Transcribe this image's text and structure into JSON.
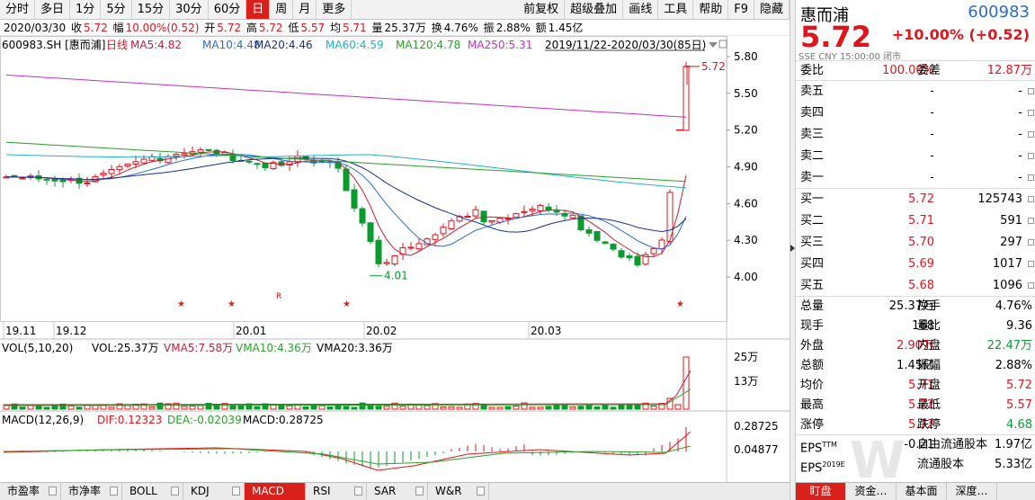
{
  "toolbar": {
    "left_items": [
      "分时",
      "多日",
      "1分",
      "5分",
      "15分",
      "30分",
      "60分",
      "日",
      "周",
      "月",
      "更多"
    ],
    "active": "日",
    "right_items": [
      "前复权",
      "超级叠加",
      "画线",
      "工具",
      "帮助",
      "F9",
      "隐藏"
    ]
  },
  "infoline": {
    "date": "2020/03/30",
    "close_label": "收",
    "close": "5.72",
    "range_label": "幅",
    "range": "10.00%(0.52)",
    "open_label": "开",
    "open": "5.72",
    "high_label": "高",
    "high": "5.72",
    "low_label": "低",
    "low": "5.57",
    "avg_label": "均",
    "avg": "5.71",
    "volume_label": "量",
    "volume": "25.37万",
    "turnover_label": "换",
    "turnover": "4.76%",
    "amp_label": "振",
    "amp": "2.88%",
    "amount_label": "额",
    "amount": "1.45亿"
  },
  "kline_legend": {
    "code": "600983.SH [惠而浦]",
    "period": "日线",
    "ma5": "MA5:4.82",
    "ma10": "MA10:4.48",
    "ma20": "MA20:4.46",
    "ma60": "MA60:4.59",
    "ma120": "MA120:4.78",
    "ma250": "MA250:5.31",
    "range_text": "2019/11/22-2020/03/30(85日)"
  },
  "price_axis": [
    "5.80",
    "5.50",
    "5.20",
    "4.90",
    "4.60",
    "4.30",
    "4.00"
  ],
  "date_axis": [
    "19.11",
    "19.12",
    "20.01",
    "20.02",
    "20.03"
  ],
  "annotations": {
    "low_label": "4.01",
    "last_label": "5.72",
    "r_mark": "R"
  },
  "vol_legend": {
    "name": "VOL(5,10,20)",
    "vol": "VOL:25.37万",
    "vma5": "VMA5:7.58万",
    "vma10": "VMA10:4.36万",
    "vma20": "VMA20:3.36万"
  },
  "vol_axis": [
    "25万",
    "13万"
  ],
  "macd_legend": {
    "name": "MACD(12,26,9)",
    "dif": "DIF:0.12323",
    "dea": "DEA:-0.02039",
    "macd": "MACD:0.28725"
  },
  "macd_axis": [
    "0.28725",
    "0.04877"
  ],
  "indicator_tabs": [
    "市盈率",
    "市净率",
    "BOLL",
    "KDJ",
    "MACD",
    "RSI",
    "SAR",
    "W&R"
  ],
  "indicator_active": "MACD",
  "quote": {
    "name": "惠而浦",
    "code": "600983",
    "price": "5.72",
    "change": "+10.00% (+0.52)",
    "sub": "SSE  CNY  15:00:00  闭市",
    "weibi_label": "委比",
    "weibi": "100.00%",
    "weicha_label": "委差",
    "weicha": "12.87万",
    "asks": [
      {
        "label": "卖五",
        "price": "-",
        "vol": "-"
      },
      {
        "label": "卖四",
        "price": "-",
        "vol": "-"
      },
      {
        "label": "卖三",
        "price": "-",
        "vol": "-"
      },
      {
        "label": "卖二",
        "price": "-",
        "vol": "-"
      },
      {
        "label": "卖一",
        "price": "-",
        "vol": "-"
      }
    ],
    "bids": [
      {
        "label": "买一",
        "price": "5.72",
        "vol": "125743"
      },
      {
        "label": "买二",
        "price": "5.71",
        "vol": "591"
      },
      {
        "label": "买三",
        "price": "5.70",
        "vol": "297"
      },
      {
        "label": "买四",
        "price": "5.69",
        "vol": "1017"
      },
      {
        "label": "买五",
        "price": "5.68",
        "vol": "1096"
      }
    ],
    "stats": [
      {
        "l1": "总量",
        "v1": "25.37万",
        "l2": "换手",
        "v2": "4.76%",
        "c1": "",
        "c2": ""
      },
      {
        "l1": "现手",
        "v1": "168",
        "l2": "量比",
        "v2": "9.36",
        "c1": "",
        "c2": ""
      },
      {
        "l1": "外盘",
        "v1": "2.90万",
        "l2": "内盘",
        "v2": "22.47万",
        "c1": "red",
        "c2": "grn"
      },
      {
        "l1": "总额",
        "v1": "1.45亿",
        "l2": "振幅",
        "v2": "2.88%",
        "c1": "",
        "c2": ""
      },
      {
        "l1": "均价",
        "v1": "5.71",
        "l2": "开盘",
        "v2": "5.72",
        "c1": "red",
        "c2": "red"
      },
      {
        "l1": "最高",
        "v1": "5.72",
        "l2": "最低",
        "v2": "5.57",
        "c1": "red",
        "c2": "red"
      },
      {
        "l1": "涨停",
        "v1": "5.72",
        "l2": "跌停",
        "v2": "4.68",
        "c1": "red",
        "c2": "grn"
      }
    ],
    "eps": [
      {
        "l1": "EPS",
        "sup1": "TTM",
        "v1": "-0.21",
        "l2": "自由流通股本",
        "v2": "1.97亿"
      },
      {
        "l1": "EPS",
        "sup1": "2019E",
        "v1": "",
        "l2": "流通股本",
        "v2": "5.33亿"
      }
    ]
  },
  "rp_tabs": [
    "盯盘",
    "资金…",
    "基本面",
    "深度…"
  ],
  "rp_tab_active": "盯盘",
  "colors": {
    "up": "#e0141b",
    "down": "#0a9b2f",
    "ma5": "#c0203a",
    "ma10": "#2a6bd1",
    "ma20": "#1b2f8f",
    "ma60": "#23aecb",
    "ma120": "#2aa02a",
    "ma250": "#c330c3"
  }
}
